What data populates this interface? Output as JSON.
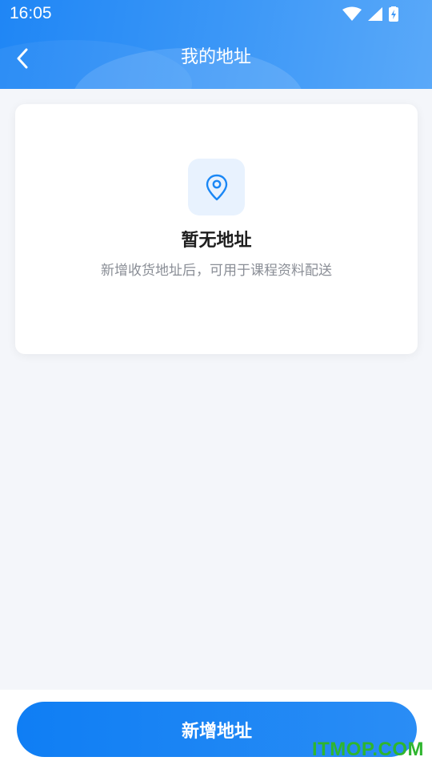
{
  "status_bar": {
    "time": "16:05",
    "icons": [
      "wifi-icon",
      "signal-icon",
      "battery-charging-icon"
    ]
  },
  "header": {
    "title": "我的地址",
    "back_icon": "chevron-left-icon"
  },
  "empty_state": {
    "icon": "location-pin-icon",
    "title": "暂无地址",
    "subtitle": "新增收货地址后，可用于课程资料配送"
  },
  "footer": {
    "add_button_label": "新增地址"
  },
  "watermark": "ITMOP.COM",
  "colors": {
    "primary": "#1a87f5",
    "icon_bg": "#e8f2fe",
    "page_bg": "#f4f6fa",
    "watermark": "#2fb52f"
  }
}
